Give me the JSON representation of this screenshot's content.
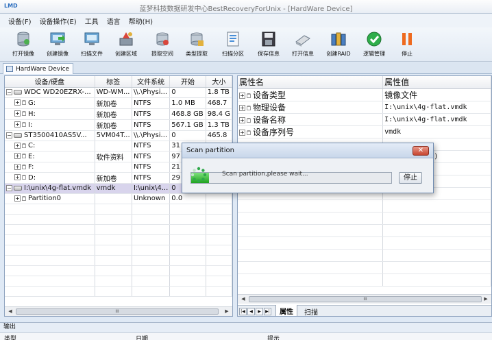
{
  "window": {
    "logo": "LMD",
    "title": "蓝梦科技数据研发中心BestRecoveryForUnix - [HardWare Device]"
  },
  "menu": [
    "设备(F)",
    "设备操作(E)",
    "工具",
    "语言",
    "帮助(H)"
  ],
  "toolbar": [
    {
      "label": "打开镜像",
      "icon": "open-image-icon"
    },
    {
      "label": "创建镜像",
      "icon": "create-image-icon"
    },
    {
      "label": "扫描文件",
      "icon": "scan-files-icon"
    },
    {
      "label": "创建区域",
      "icon": "create-region-icon"
    },
    {
      "label": "提取空间",
      "icon": "extract-space-icon"
    },
    {
      "label": "类型提取",
      "icon": "type-extract-icon"
    },
    {
      "label": "扫描分区",
      "icon": "scan-partition-icon"
    },
    {
      "label": "保存信息",
      "icon": "save-info-icon"
    },
    {
      "label": "打开信息",
      "icon": "open-info-icon"
    },
    {
      "label": "创建RAID",
      "icon": "create-raid-icon"
    },
    {
      "label": "逻辑管理",
      "icon": "logic-manage-icon"
    },
    {
      "label": "停止",
      "icon": "stop-icon"
    }
  ],
  "doc_tab": "HardWare Device",
  "device_table": {
    "columns": [
      "设备/硬盘",
      "标签",
      "文件系统",
      "开始",
      "大小"
    ],
    "rows": [
      {
        "name": "WDC WD20EZRX-...",
        "label": "WD-WM...",
        "fs": "\\\\.\\Physi...",
        "start": "0",
        "size": "1.8 TB",
        "kind": "disk",
        "indent": 0
      },
      {
        "name": "G:",
        "label": "新加卷",
        "fs": "NTFS",
        "start": "1.0 MB",
        "size": "468.7",
        "kind": "vol",
        "indent": 1
      },
      {
        "name": "H:",
        "label": "新加卷",
        "fs": "NTFS",
        "start": "468.8 GB",
        "size": "98.4 G",
        "kind": "vol",
        "indent": 1
      },
      {
        "name": "I:",
        "label": "新加卷",
        "fs": "NTFS",
        "start": "567.1 GB",
        "size": "1.3 TB",
        "kind": "vol",
        "indent": 1
      },
      {
        "name": "ST3500410AS5V...",
        "label": "5VM04T...",
        "fs": "\\\\.\\Physi...",
        "start": "0",
        "size": "465.8",
        "kind": "disk",
        "indent": 0
      },
      {
        "name": "C:",
        "label": "",
        "fs": "NTFS",
        "start": "31",
        "size": "",
        "kind": "vol",
        "indent": 1
      },
      {
        "name": "E:",
        "label": "软件资料",
        "fs": "NTFS",
        "start": "97",
        "size": "",
        "kind": "vol",
        "indent": 1
      },
      {
        "name": "F:",
        "label": "",
        "fs": "NTFS",
        "start": "21",
        "size": "",
        "kind": "vol",
        "indent": 1
      },
      {
        "name": "D:",
        "label": "新加卷",
        "fs": "NTFS",
        "start": "29",
        "size": "",
        "kind": "vol",
        "indent": 1
      },
      {
        "name": "I:\\unix\\4g-flat.vmdk",
        "label": "vmdk",
        "fs": "I:\\unix\\4...",
        "start": "0",
        "size": "",
        "kind": "disk",
        "indent": 0,
        "selected": true
      },
      {
        "name": "Partition0",
        "label": "",
        "fs": "Unknown",
        "start": "0.0",
        "size": "",
        "kind": "vol",
        "indent": 1
      }
    ]
  },
  "props_table": {
    "columns": [
      "属性名",
      "属性值"
    ],
    "rows": [
      {
        "name": "设备类型",
        "value": "镜像文件"
      },
      {
        "name": "物理设备",
        "value": "I:\\unix\\4g-flat.vmdk"
      },
      {
        "name": "设备名称",
        "value": "I:\\unix\\4g-flat.vmdk"
      },
      {
        "name": "设备序列号",
        "value": "vmdk"
      },
      {
        "name": "",
        "value": ""
      },
      {
        "name": "",
        "value": "8608 sectors)"
      }
    ]
  },
  "right_tabs": [
    "属性",
    "扫描"
  ],
  "output": {
    "title": "输出",
    "columns": [
      "类型",
      "日期",
      "提示"
    ]
  },
  "dialog": {
    "title": "Scan partition",
    "close": "✕",
    "stop": "停止",
    "message": "Scan partition,please wait...",
    "progress": 0.09
  },
  "colors": {
    "accent": "#2d6fbf",
    "selection": "#d8d4ec",
    "progress": "#1fa31f"
  }
}
